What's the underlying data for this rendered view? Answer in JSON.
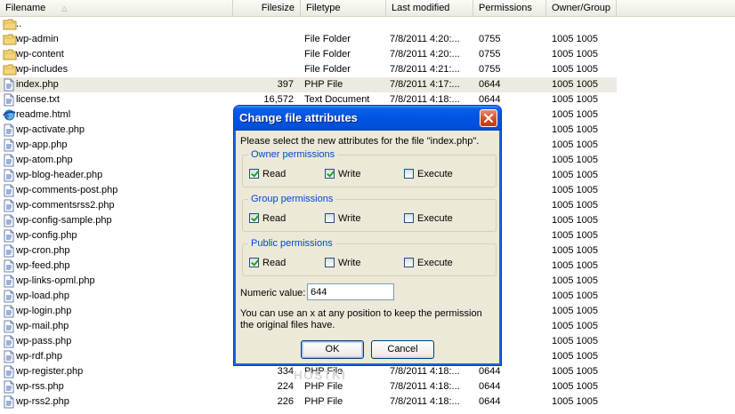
{
  "columns": {
    "filename": "Filename",
    "filesize": "Filesize",
    "filetype": "Filetype",
    "last_modified": "Last modified",
    "permissions": "Permissions",
    "owner_group": "Owner/Group"
  },
  "files": [
    {
      "name": "..",
      "size": "",
      "type": "",
      "modified": "",
      "perms": "",
      "owner": "",
      "icon": "folder-icon"
    },
    {
      "name": "wp-admin",
      "size": "",
      "type": "File Folder",
      "modified": "7/8/2011 4:20:...",
      "perms": "0755",
      "owner": "1005 1005",
      "icon": "folder-icon"
    },
    {
      "name": "wp-content",
      "size": "",
      "type": "File Folder",
      "modified": "7/8/2011 4:20:...",
      "perms": "0755",
      "owner": "1005 1005",
      "icon": "folder-icon"
    },
    {
      "name": "wp-includes",
      "size": "",
      "type": "File Folder",
      "modified": "7/8/2011 4:21:...",
      "perms": "0755",
      "owner": "1005 1005",
      "icon": "folder-icon"
    },
    {
      "name": "index.php",
      "size": "397",
      "type": "PHP File",
      "modified": "7/8/2011 4:17:...",
      "perms": "0644",
      "owner": "1005 1005",
      "icon": "file-icon",
      "selected": true
    },
    {
      "name": "license.txt",
      "size": "16,572",
      "type": "Text Document",
      "modified": "7/8/2011 4:18:...",
      "perms": "0644",
      "owner": "1005 1005",
      "icon": "file-icon"
    },
    {
      "name": "readme.html",
      "size": "",
      "type": "",
      "modified": "",
      "perms": "",
      "owner": "1005 1005",
      "icon": "html-icon"
    },
    {
      "name": "wp-activate.php",
      "size": "",
      "type": "",
      "modified": "",
      "perms": "",
      "owner": "1005 1005",
      "icon": "file-icon"
    },
    {
      "name": "wp-app.php",
      "size": "",
      "type": "",
      "modified": "",
      "perms": "",
      "owner": "1005 1005",
      "icon": "file-icon"
    },
    {
      "name": "wp-atom.php",
      "size": "",
      "type": "",
      "modified": "",
      "perms": "",
      "owner": "1005 1005",
      "icon": "file-icon"
    },
    {
      "name": "wp-blog-header.php",
      "size": "",
      "type": "",
      "modified": "",
      "perms": "",
      "owner": "1005 1005",
      "icon": "file-icon"
    },
    {
      "name": "wp-comments-post.php",
      "size": "",
      "type": "",
      "modified": "",
      "perms": "",
      "owner": "1005 1005",
      "icon": "file-icon"
    },
    {
      "name": "wp-commentsrss2.php",
      "size": "",
      "type": "",
      "modified": "",
      "perms": "",
      "owner": "1005 1005",
      "icon": "file-icon"
    },
    {
      "name": "wp-config-sample.php",
      "size": "",
      "type": "",
      "modified": "",
      "perms": "",
      "owner": "1005 1005",
      "icon": "file-icon"
    },
    {
      "name": "wp-config.php",
      "size": "",
      "type": "",
      "modified": "",
      "perms": "",
      "owner": "1005 1005",
      "icon": "file-icon"
    },
    {
      "name": "wp-cron.php",
      "size": "",
      "type": "",
      "modified": "",
      "perms": "",
      "owner": "1005 1005",
      "icon": "file-icon"
    },
    {
      "name": "wp-feed.php",
      "size": "",
      "type": "",
      "modified": "",
      "perms": "",
      "owner": "1005 1005",
      "icon": "file-icon"
    },
    {
      "name": "wp-links-opml.php",
      "size": "",
      "type": "",
      "modified": "",
      "perms": "",
      "owner": "1005 1005",
      "icon": "file-icon"
    },
    {
      "name": "wp-load.php",
      "size": "",
      "type": "",
      "modified": "",
      "perms": "",
      "owner": "1005 1005",
      "icon": "file-icon"
    },
    {
      "name": "wp-login.php",
      "size": "",
      "type": "",
      "modified": "",
      "perms": "",
      "owner": "1005 1005",
      "icon": "file-icon"
    },
    {
      "name": "wp-mail.php",
      "size": "",
      "type": "",
      "modified": "",
      "perms": "",
      "owner": "1005 1005",
      "icon": "file-icon"
    },
    {
      "name": "wp-pass.php",
      "size": "",
      "type": "",
      "modified": "",
      "perms": "",
      "owner": "1005 1005",
      "icon": "file-icon"
    },
    {
      "name": "wp-rdf.php",
      "size": "",
      "type": "",
      "modified": "",
      "perms": "",
      "owner": "1005 1005",
      "icon": "file-icon"
    },
    {
      "name": "wp-register.php",
      "size": "334",
      "type": "PHP File",
      "modified": "7/8/2011 4:18:...",
      "perms": "0644",
      "owner": "1005 1005",
      "icon": "file-icon"
    },
    {
      "name": "wp-rss.php",
      "size": "224",
      "type": "PHP File",
      "modified": "7/8/2011 4:18:...",
      "perms": "0644",
      "owner": "1005 1005",
      "icon": "file-icon"
    },
    {
      "name": "wp-rss2.php",
      "size": "226",
      "type": "PHP File",
      "modified": "7/8/2011 4:18:...",
      "perms": "0644",
      "owner": "1005 1005",
      "icon": "file-icon"
    }
  ],
  "dialog": {
    "title": "Change file attributes",
    "description": "Please select the new attributes for the file \"index.php\".",
    "groups": [
      {
        "label": "Owner permissions",
        "read": true,
        "write": true,
        "execute": false
      },
      {
        "label": "Group permissions",
        "read": true,
        "write": false,
        "execute": false
      },
      {
        "label": "Public permissions",
        "read": true,
        "write": false,
        "execute": false
      }
    ],
    "read_label": "Read",
    "write_label": "Write",
    "execute_label": "Execute",
    "numeric_label": "Numeric value:",
    "numeric_value": "644",
    "help_text": "You can use an x at any position to keep the permission the original files have.",
    "ok_label": "OK",
    "cancel_label": "Cancel"
  },
  "watermark": "HOSTKI",
  "colors": {
    "titlebar": "#0054e3",
    "selection": "#edebe1",
    "group_label": "#0046d5",
    "close_button": "#d04a23",
    "check": "#21a121"
  }
}
